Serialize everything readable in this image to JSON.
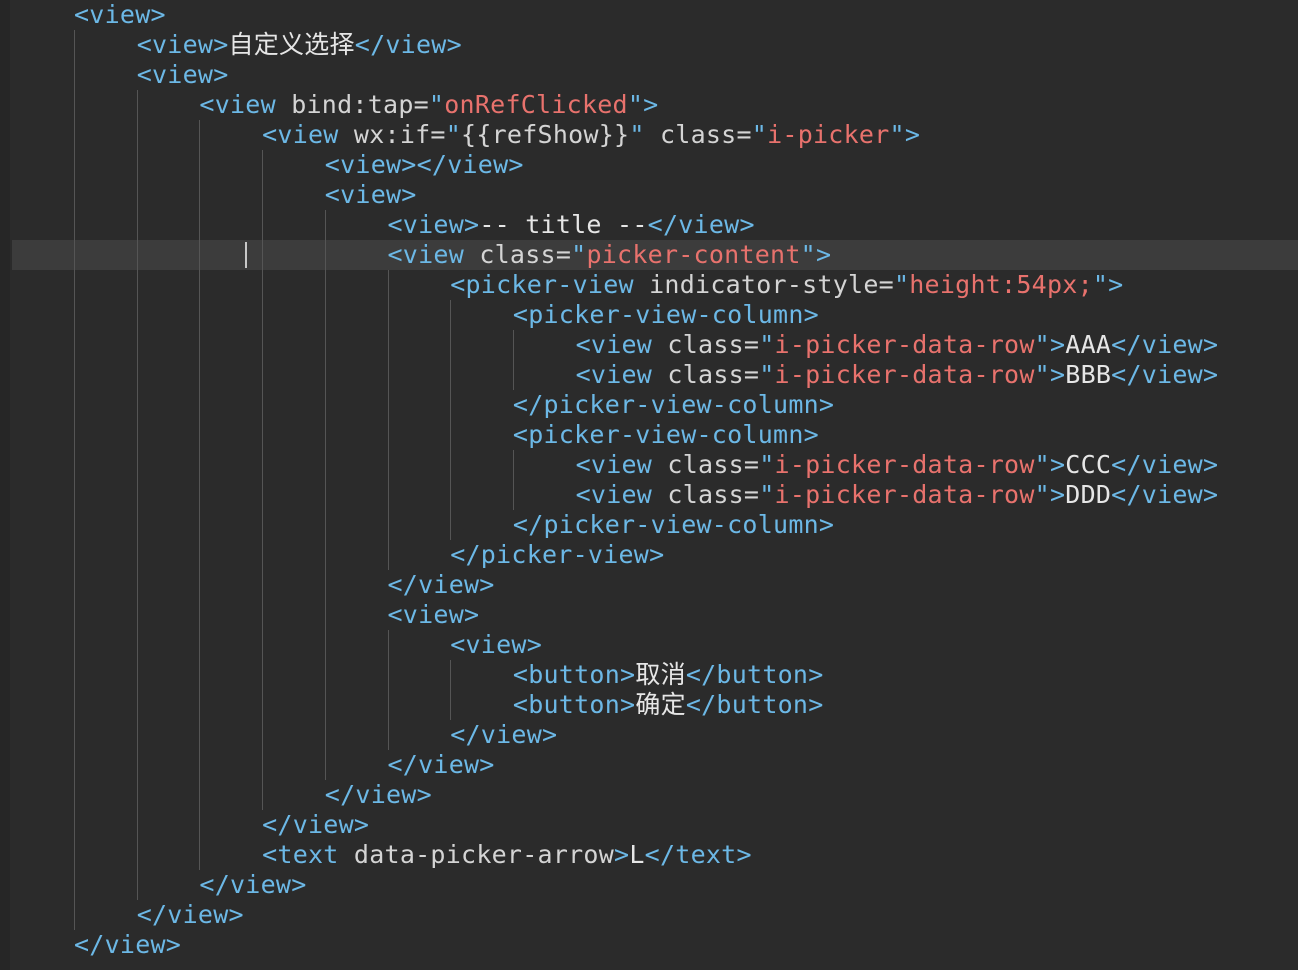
{
  "colors": {
    "background": "#2b2b2b",
    "current_line": "#3c3c3c",
    "tag": "#6cb8e6",
    "attribute": "#d4d4d4",
    "string": "#e8726d",
    "text": "#e6e6e6",
    "indent_guide": "#555555"
  },
  "editor": {
    "lines": [
      {
        "indent": 0,
        "segments": [
          {
            "t": "tag",
            "v": "<view>"
          }
        ]
      },
      {
        "indent": 1,
        "segments": [
          {
            "t": "tag",
            "v": "<view>"
          },
          {
            "t": "txt",
            "v": "自定义选择"
          },
          {
            "t": "tag",
            "v": "</view>"
          }
        ]
      },
      {
        "indent": 1,
        "segments": [
          {
            "t": "tag",
            "v": "<view>"
          }
        ]
      },
      {
        "indent": 2,
        "segments": [
          {
            "t": "tag",
            "v": "<view"
          },
          {
            "t": "attr",
            "v": " bind:tap="
          },
          {
            "t": "tag",
            "v": "\""
          },
          {
            "t": "str",
            "v": "onRefClicked"
          },
          {
            "t": "tag",
            "v": "\">"
          }
        ]
      },
      {
        "indent": 3,
        "segments": [
          {
            "t": "tag",
            "v": "<view"
          },
          {
            "t": "attr",
            "v": " wx:if="
          },
          {
            "t": "tag",
            "v": "\""
          },
          {
            "t": "attr",
            "v": "{{refShow}}"
          },
          {
            "t": "tag",
            "v": "\""
          },
          {
            "t": "attr",
            "v": " class="
          },
          {
            "t": "tag",
            "v": "\""
          },
          {
            "t": "str",
            "v": "i-picker"
          },
          {
            "t": "tag",
            "v": "\">"
          }
        ]
      },
      {
        "indent": 4,
        "segments": [
          {
            "t": "tag",
            "v": "<view></view>"
          }
        ]
      },
      {
        "indent": 4,
        "segments": [
          {
            "t": "tag",
            "v": "<view>"
          }
        ]
      },
      {
        "indent": 5,
        "segments": [
          {
            "t": "tag",
            "v": "<view>"
          },
          {
            "t": "txt",
            "v": "-- title --"
          },
          {
            "t": "tag",
            "v": "</view>"
          }
        ]
      },
      {
        "indent": 5,
        "segments": [
          {
            "t": "tag",
            "v": "<view"
          },
          {
            "t": "attr",
            "v": " class="
          },
          {
            "t": "tag",
            "v": "\""
          },
          {
            "t": "str",
            "v": "picker-content"
          },
          {
            "t": "tag",
            "v": "\">"
          }
        ]
      },
      {
        "indent": 6,
        "segments": [
          {
            "t": "tag",
            "v": "<picker-view"
          },
          {
            "t": "attr",
            "v": " indicator-style="
          },
          {
            "t": "tag",
            "v": "\""
          },
          {
            "t": "str",
            "v": "height:54px;"
          },
          {
            "t": "tag",
            "v": "\">"
          }
        ]
      },
      {
        "indent": 7,
        "segments": [
          {
            "t": "tag",
            "v": "<picker-view-column>"
          }
        ]
      },
      {
        "indent": 8,
        "segments": [
          {
            "t": "tag",
            "v": "<view"
          },
          {
            "t": "attr",
            "v": " class="
          },
          {
            "t": "tag",
            "v": "\""
          },
          {
            "t": "str",
            "v": "i-picker-data-row"
          },
          {
            "t": "tag",
            "v": "\">"
          },
          {
            "t": "txt",
            "v": "AAA"
          },
          {
            "t": "tag",
            "v": "</view>"
          }
        ]
      },
      {
        "indent": 8,
        "segments": [
          {
            "t": "tag",
            "v": "<view"
          },
          {
            "t": "attr",
            "v": " class="
          },
          {
            "t": "tag",
            "v": "\""
          },
          {
            "t": "str",
            "v": "i-picker-data-row"
          },
          {
            "t": "tag",
            "v": "\">"
          },
          {
            "t": "txt",
            "v": "BBB"
          },
          {
            "t": "tag",
            "v": "</view>"
          }
        ]
      },
      {
        "indent": 7,
        "segments": [
          {
            "t": "tag",
            "v": "</picker-view-column>"
          }
        ]
      },
      {
        "indent": 7,
        "segments": [
          {
            "t": "tag",
            "v": "<picker-view-column>"
          }
        ]
      },
      {
        "indent": 8,
        "segments": [
          {
            "t": "tag",
            "v": "<view"
          },
          {
            "t": "attr",
            "v": " class="
          },
          {
            "t": "tag",
            "v": "\""
          },
          {
            "t": "str",
            "v": "i-picker-data-row"
          },
          {
            "t": "tag",
            "v": "\">"
          },
          {
            "t": "txt",
            "v": "CCC"
          },
          {
            "t": "tag",
            "v": "</view>"
          }
        ]
      },
      {
        "indent": 8,
        "segments": [
          {
            "t": "tag",
            "v": "<view"
          },
          {
            "t": "attr",
            "v": " class="
          },
          {
            "t": "tag",
            "v": "\""
          },
          {
            "t": "str",
            "v": "i-picker-data-row"
          },
          {
            "t": "tag",
            "v": "\">"
          },
          {
            "t": "txt",
            "v": "DDD"
          },
          {
            "t": "tag",
            "v": "</view>"
          }
        ]
      },
      {
        "indent": 7,
        "segments": [
          {
            "t": "tag",
            "v": "</picker-view-column>"
          }
        ]
      },
      {
        "indent": 6,
        "segments": [
          {
            "t": "tag",
            "v": "</picker-view>"
          }
        ]
      },
      {
        "indent": 5,
        "segments": [
          {
            "t": "tag",
            "v": "</view>"
          }
        ]
      },
      {
        "indent": 5,
        "segments": [
          {
            "t": "tag",
            "v": "<view>"
          }
        ]
      },
      {
        "indent": 6,
        "segments": [
          {
            "t": "tag",
            "v": "<view>"
          }
        ]
      },
      {
        "indent": 7,
        "segments": [
          {
            "t": "tag",
            "v": "<button>"
          },
          {
            "t": "txt",
            "v": "取消"
          },
          {
            "t": "tag",
            "v": "</button>"
          }
        ]
      },
      {
        "indent": 7,
        "segments": [
          {
            "t": "tag",
            "v": "<button>"
          },
          {
            "t": "txt",
            "v": "确定"
          },
          {
            "t": "tag",
            "v": "</button>"
          }
        ]
      },
      {
        "indent": 6,
        "segments": [
          {
            "t": "tag",
            "v": "</view>"
          }
        ]
      },
      {
        "indent": 5,
        "segments": [
          {
            "t": "tag",
            "v": "</view>"
          }
        ]
      },
      {
        "indent": 4,
        "segments": [
          {
            "t": "tag",
            "v": "</view>"
          }
        ]
      },
      {
        "indent": 3,
        "segments": [
          {
            "t": "tag",
            "v": "</view>"
          }
        ]
      },
      {
        "indent": 3,
        "segments": [
          {
            "t": "tag",
            "v": "<text"
          },
          {
            "t": "attr",
            "v": " data-picker-arrow"
          },
          {
            "t": "tag",
            "v": ">"
          },
          {
            "t": "txt",
            "v": "L"
          },
          {
            "t": "tag",
            "v": "</text>"
          }
        ]
      },
      {
        "indent": 2,
        "segments": [
          {
            "t": "tag",
            "v": "</view>"
          }
        ]
      },
      {
        "indent": 1,
        "segments": [
          {
            "t": "tag",
            "v": "</view>"
          }
        ]
      },
      {
        "indent": 0,
        "segments": [
          {
            "t": "tag",
            "v": "</view>"
          }
        ]
      }
    ]
  }
}
